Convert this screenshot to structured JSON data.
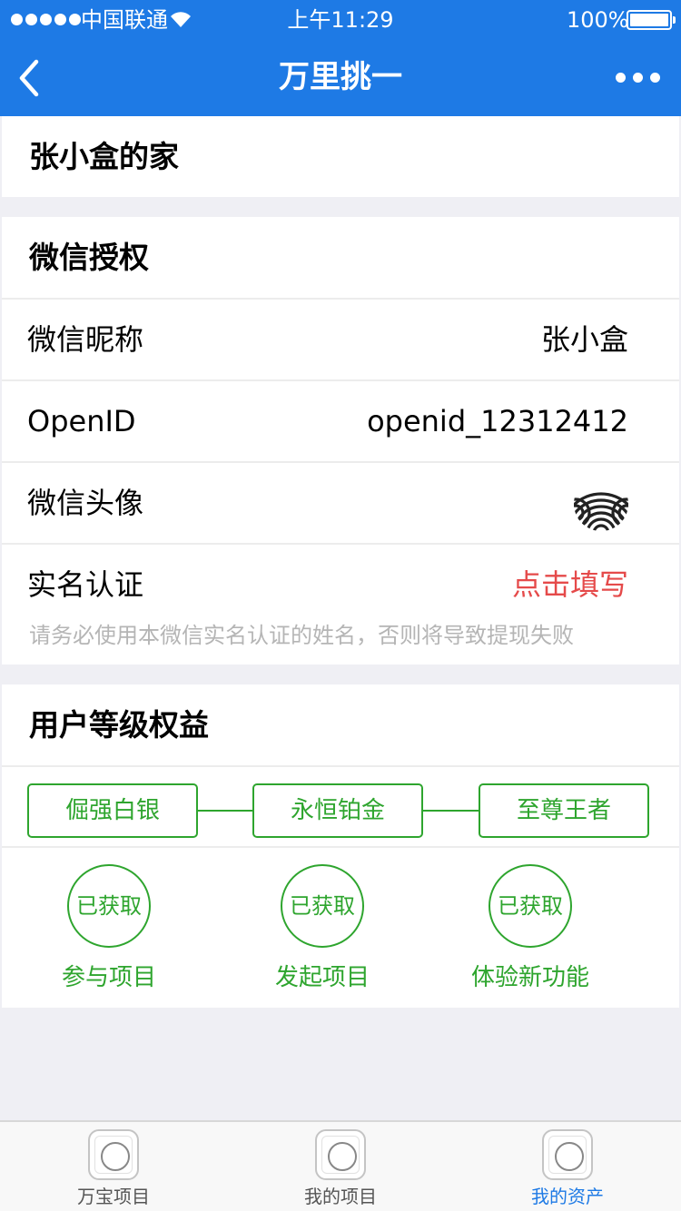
{
  "status_bar": {
    "carrier": "中国联通",
    "time": "上午11:29",
    "battery": "100%"
  },
  "nav": {
    "title": "万里挑一",
    "back_icon": "chevron-left-icon",
    "more_icon": "more-icon"
  },
  "home": {
    "title": "张小盒的家"
  },
  "wechat_auth": {
    "title": "微信授权",
    "nickname_label": "微信昵称",
    "nickname_value": "张小盒",
    "openid_label": "OpenID",
    "openid_value": "openid_12312412",
    "avatar_label": "微信头像",
    "realname_label": "实名认证",
    "realname_value": "点击填写",
    "realname_hint": "请务必使用本微信实名认证的姓名，否则将导致提现失败"
  },
  "user_level": {
    "title": "用户等级权益",
    "levels": [
      "倔强白银",
      "永恒铂金",
      "至尊王者"
    ],
    "perks": [
      {
        "status": "已获取",
        "label": "参与项目"
      },
      {
        "status": "已获取",
        "label": "发起项目"
      },
      {
        "status": "已获取",
        "label": "体验新功能"
      }
    ]
  },
  "tab_bar": {
    "tabs": [
      {
        "label": "万宝项目",
        "active": false
      },
      {
        "label": "我的项目",
        "active": false
      },
      {
        "label": "我的资产",
        "active": true
      }
    ]
  },
  "colors": {
    "primary": "#1e7ae5",
    "green": "#2ea52e",
    "red": "#e54a4a",
    "hint": "#b5b5b5"
  }
}
